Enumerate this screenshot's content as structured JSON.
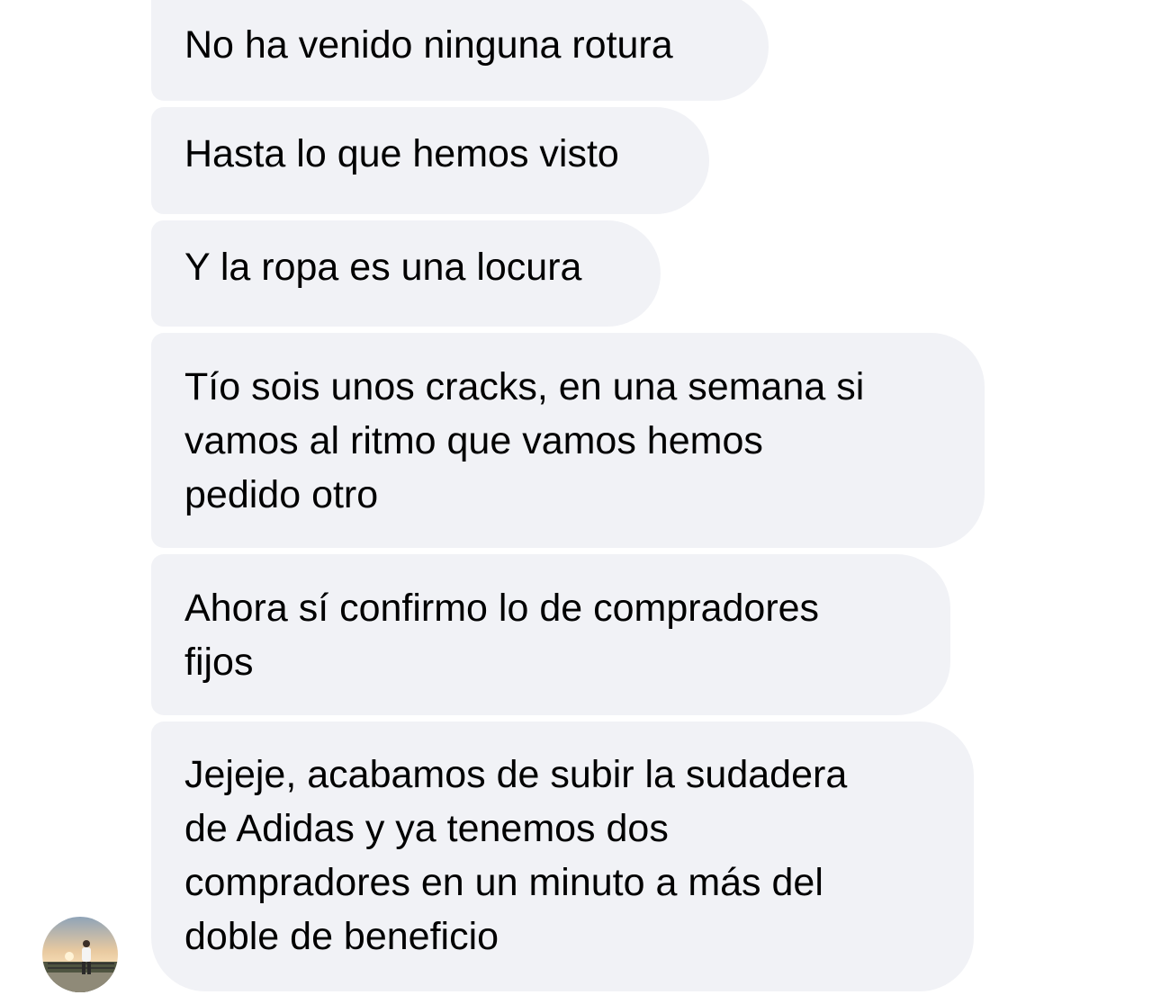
{
  "conversation": {
    "messages": [
      {
        "text": "No ha venido ninguna rotura"
      },
      {
        "text": "Hasta lo que hemos visto"
      },
      {
        "text": "Y la ropa es una locura"
      },
      {
        "text": "Tío sois unos cracks, en una semana si\nvamos al ritmo que vamos hemos\npedido otro"
      },
      {
        "text": "Ahora sí confirmo lo de compradores\nfijos"
      },
      {
        "text": "Jejeje, acabamos de subir la sudadera\nde Adidas y ya tenemos dos\ncompradores en un minuto a más del\ndoble de beneficio"
      }
    ],
    "sender_avatar": {
      "icon": "profile-photo-sunset-person"
    }
  },
  "colors": {
    "bubble_background": "#f1f2f6",
    "text": "#000000",
    "page_background": "#ffffff"
  }
}
